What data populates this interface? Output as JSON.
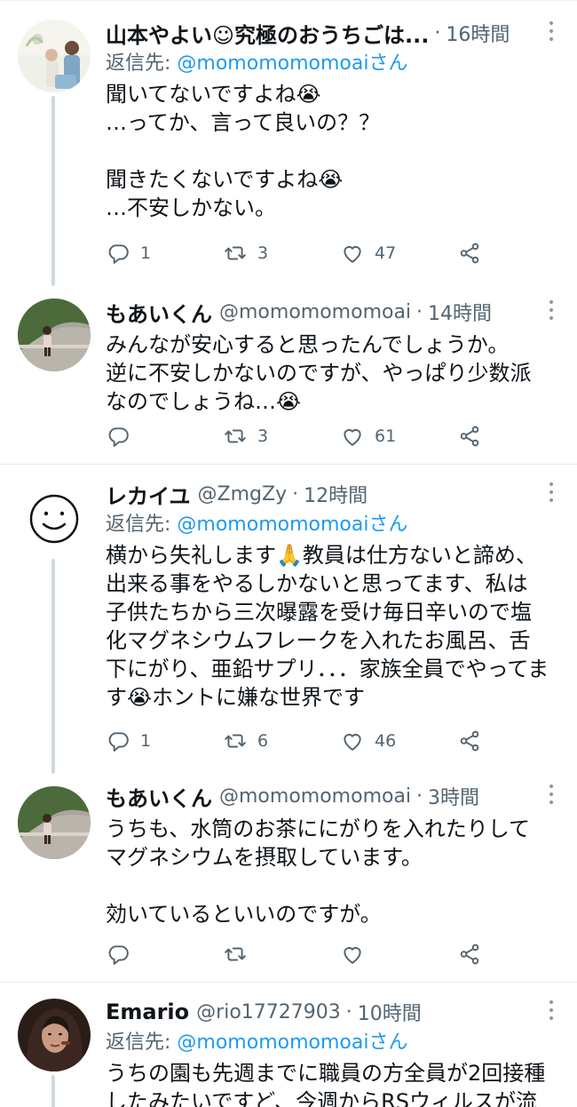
{
  "tweets": [
    {
      "name": "山本やよい☺究極のおうちごは...",
      "handle": "",
      "time": "16時間",
      "reply_to_label": "返信先: ",
      "reply_to_mention": "@momomomomoaiさん",
      "body": "聞いてないですよね😭\n…ってか、言って良いの？？\n\n聞きたくないですよね😭\n…不安しかない。",
      "reply_count": "1",
      "retweet_count": "3",
      "like_count": "47"
    },
    {
      "name": "もあいくん",
      "handle": "@momomomomoai",
      "time": "14時間",
      "reply_to_label": "",
      "reply_to_mention": "",
      "body": "みんなが安心すると思ったんでしょうか。\n逆に不安しかないのですが、やっぱり少数派\nなのでしょうね…😭",
      "reply_count": "",
      "retweet_count": "3",
      "like_count": "61"
    },
    {
      "name": "レカイユ",
      "handle": "@ZmgZy",
      "time": "12時間",
      "reply_to_label": "返信先: ",
      "reply_to_mention": "@momomomomoaiさん",
      "body": "横から失礼します🙏教員は仕方ないと諦め、\n出来る事をやるしかないと思ってます、私は\n子供たちから三次曝露を受け毎日辛いので塩\n化マグネシウムフレークを入れたお風呂、舌\n下にがり、亜鉛サプリ．．．家族全員でやってま\nす😭ホントに嫌な世界です",
      "reply_count": "1",
      "retweet_count": "6",
      "like_count": "46"
    },
    {
      "name": "もあいくん",
      "handle": "@momomomomoai",
      "time": "3時間",
      "reply_to_label": "",
      "reply_to_mention": "",
      "body": "うちも、水筒のお茶ににがりを入れたりして\nマグネシウムを摂取しています。\n\n効いているといいのですが。",
      "reply_count": "",
      "retweet_count": "",
      "like_count": ""
    },
    {
      "name": "Emario",
      "handle": "@rio17727903",
      "time": "10時間",
      "reply_to_label": "返信先: ",
      "reply_to_mention": "@momomomomoaiさん",
      "body": "うちの園も先週までに職員の方全員が2回接種\nしたみたいですど、今週からRSウィルスが流",
      "reply_count": "",
      "retweet_count": "",
      "like_count": ""
    }
  ],
  "separator": "·",
  "icons": {
    "reply": "reply-icon",
    "retweet": "retweet-icon",
    "like": "like-icon",
    "share": "share-icon",
    "more": "more-icon"
  },
  "colors": {
    "text": "#0f1419",
    "secondary": "#536471",
    "mention": "#1d9bf0",
    "thread_line": "#cfd9de"
  }
}
